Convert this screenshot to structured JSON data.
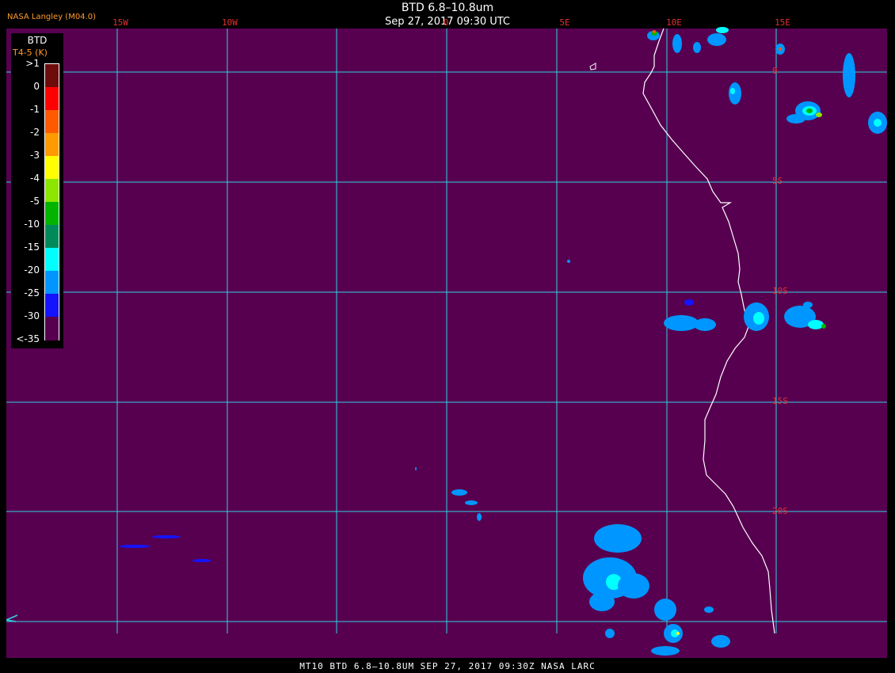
{
  "header": {
    "title": "BTD 6.8–10.8um",
    "datetime": "Sep 27, 2017 09:30 UTC",
    "organization": "NASA Langley (M04.0)"
  },
  "footer": {
    "text": "MT10  BTD 6.8–10.8UM   SEP 27, 2017 09:30Z   NASA LARC"
  },
  "map": {
    "background_color": "#570050",
    "grid_color": "#2fd3e0",
    "coast_color": "#ffffff",
    "label_color": "#e23030",
    "longitude_labels": [
      "15W",
      "10W",
      "0",
      "5E",
      "10E",
      "15E"
    ],
    "latitude_labels": [
      "0",
      "5S",
      "10S",
      "15S",
      "20S"
    ],
    "extent": {
      "lon_min": -20,
      "lon_max": 20,
      "lat_max": 2,
      "lat_min": -27
    }
  },
  "legend": {
    "title": "BTD",
    "units": "T4-5 (K)",
    "ticks": [
      ">1",
      "0",
      "-1",
      "-2",
      "-3",
      "-4",
      "-5",
      "-10",
      "-15",
      "-20",
      "-25",
      "-30",
      "<-35"
    ],
    "colors": [
      "#6e0c0c",
      "#ff0000",
      "#ff5a00",
      "#ff9a00",
      "#ffff00",
      "#8ce600",
      "#00b400",
      "#008a5a",
      "#00ffff",
      "#0096ff",
      "#1414ff",
      "#570050"
    ]
  }
}
